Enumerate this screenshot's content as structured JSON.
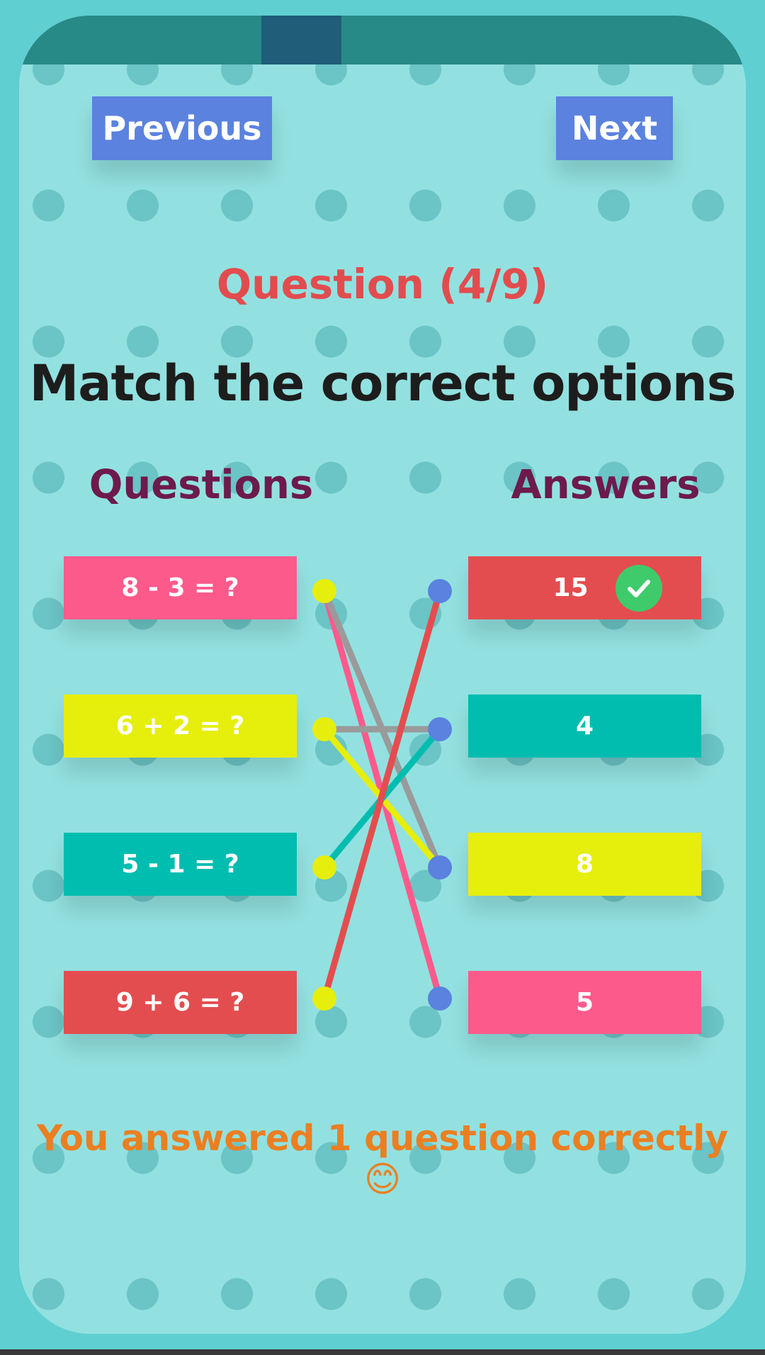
{
  "progress": {
    "current": 4,
    "total": 9,
    "fraction": 0.444
  },
  "nav": {
    "previous_label": "Previous",
    "next_label": "Next"
  },
  "question_counter": "Question (4/9)",
  "prompt": "Match the correct options",
  "columns": {
    "questions_heading": "Questions",
    "answers_heading": "Answers"
  },
  "questions": [
    {
      "text": "8 - 3 = ?",
      "color": "#fd5a8c"
    },
    {
      "text": "6 + 2 = ?",
      "color": "#e6ee0b"
    },
    {
      "text": "5 - 1 = ?",
      "color": "#01bdaf"
    },
    {
      "text": "9 + 6 = ?",
      "color": "#e44d4f"
    }
  ],
  "answers": [
    {
      "text": "15",
      "color": "#e44d4f",
      "correct": true
    },
    {
      "text": "4",
      "color": "#01bdaf",
      "correct": false
    },
    {
      "text": "8",
      "color": "#e6ee0b",
      "correct": false
    },
    {
      "text": "5",
      "color": "#fd5a8c",
      "correct": false
    }
  ],
  "connections": [
    {
      "from_question": 0,
      "to_answer": 3,
      "color": "#fd5a8c"
    },
    {
      "from_question": 0,
      "to_answer": 2,
      "color": "#9a9a9a"
    },
    {
      "from_question": 1,
      "to_answer": 1,
      "color": "#9a9a9a"
    },
    {
      "from_question": 1,
      "to_answer": 2,
      "color": "#e6ee0b"
    },
    {
      "from_question": 2,
      "to_answer": 1,
      "color": "#01bdaf"
    },
    {
      "from_question": 3,
      "to_answer": 0,
      "color": "#e44d4f"
    }
  ],
  "result_text": "You answered 1 question correctly 😊",
  "colors": {
    "background": "#5fcfd1",
    "panel": "#92e1e0",
    "progress_track": "#278a87",
    "progress_fill": "#1f5d79",
    "button": "#5b82de",
    "question_counter": "#e24c4e",
    "heading": "#6d1a4c",
    "result": "#ea7f22",
    "left_dot": "#e6ee0b",
    "right_dot": "#5b82de",
    "check": "#3fcb6b"
  }
}
